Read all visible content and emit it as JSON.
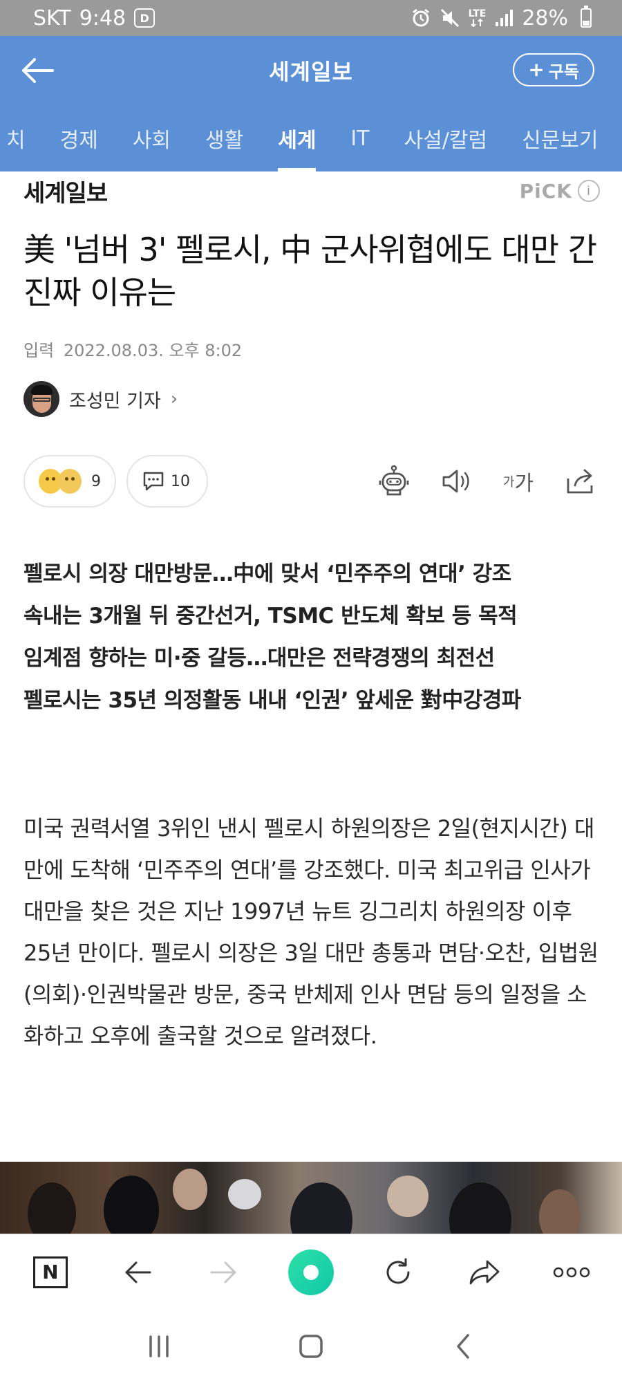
{
  "status_bar": {
    "carrier": "SKT",
    "time": "9:48",
    "app_notification_glyph": "D",
    "network": "LTE",
    "battery": "28%",
    "battery_level": 0.28
  },
  "header": {
    "title": "세계일보",
    "subscribe_label": "구독",
    "subscribe_plus": "+"
  },
  "tabs": {
    "items": [
      {
        "label": "치",
        "active": false
      },
      {
        "label": "경제",
        "active": false
      },
      {
        "label": "사회",
        "active": false
      },
      {
        "label": "생활",
        "active": false
      },
      {
        "label": "세계",
        "active": true
      },
      {
        "label": "IT",
        "active": false
      },
      {
        "label": "사설/칼럼",
        "active": false
      },
      {
        "label": "신문보기",
        "active": false
      }
    ]
  },
  "article": {
    "press_name": "세계일보",
    "pick_label": "PiCK",
    "pick_info_glyph": "i",
    "headline": "美 '넘버 3' 펠로시, 中 군사위협에도 대만 간 진짜 이유는",
    "date_prefix": "입력",
    "date": "2022.08.03. 오후 8:02",
    "reporter": "조성민 기자",
    "reporter_chevron": "›",
    "reaction_count": "9",
    "comment_count": "10",
    "font_size_small": "가",
    "font_size_large": "가",
    "summary": [
      "펠로시 의장 대만방문…中에 맞서 ‘민주주의 연대’ 강조",
      "속내는 3개월 뒤 중간선거, TSMC 반도체 확보 등 목적",
      "임계점 향하는 미·중 갈등…대만은 전략경쟁의 최전선",
      "펠로시는 35년 의정활동 내내 ‘인권’ 앞세운 對中강경파"
    ],
    "body": "미국 권력서열 3위인 낸시 펠로시 하원의장은 2일(현지시간) 대만에 도착해 ‘민주주의 연대’를 강조했다. 미국 최고위급 인사가 대만을 찾은 것은 지난 1997년 뉴트 깅그리치 하원의장 이후 25년 만이다. 펠로시 의장은 3일 대만 총통과 면담·오찬, 입법원(의회)·인권박물관 방문, 중국 반체제 인사 면담 등의 일정을 소화하고 오후에 출국할 것으로 알려졌다."
  },
  "browser_bar": {
    "home_label": "N"
  },
  "colors": {
    "header_bg": "#5b8fd6",
    "status_bg": "#9a9a9a",
    "green_button": "#1fd3a8"
  }
}
